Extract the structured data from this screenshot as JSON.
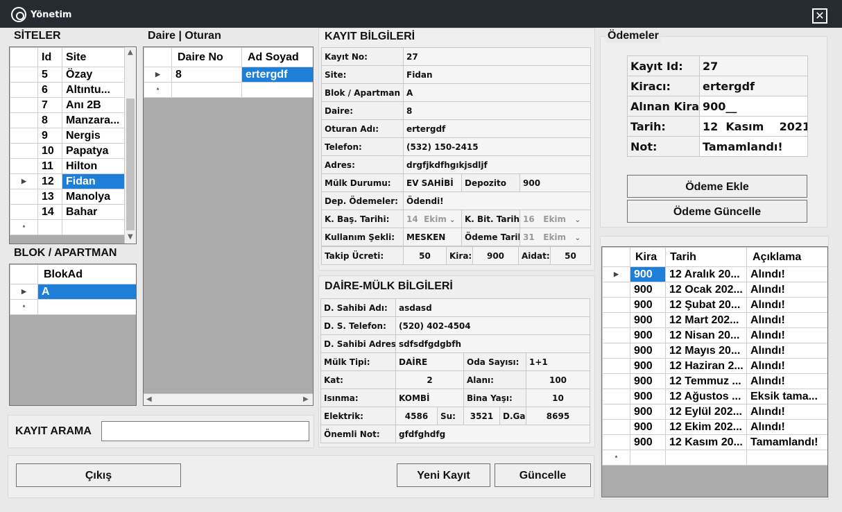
{
  "window": {
    "title": "Yönetim",
    "close": "✕"
  },
  "siteler": {
    "title": "SİTELER",
    "headers": [
      "Id",
      "Site"
    ],
    "rows": [
      {
        "marker": "",
        "id": "5",
        "site": "Özay"
      },
      {
        "marker": "",
        "id": "6",
        "site": "Altıntu..."
      },
      {
        "marker": "",
        "id": "7",
        "site": "Anı 2B"
      },
      {
        "marker": "",
        "id": "8",
        "site": "Manzara..."
      },
      {
        "marker": "",
        "id": "9",
        "site": "Nergis"
      },
      {
        "marker": "",
        "id": "10",
        "site": "Papatya"
      },
      {
        "marker": "",
        "id": "11",
        "site": "Hilton"
      },
      {
        "marker": "▶",
        "id": "12",
        "site": "Fidan"
      },
      {
        "marker": "",
        "id": "13",
        "site": "Manolya"
      },
      {
        "marker": "",
        "id": "14",
        "site": "Bahar"
      },
      {
        "marker": "*",
        "id": "",
        "site": ""
      }
    ]
  },
  "blok": {
    "title": "BLOK / APARTMAN",
    "header": "BlokAd",
    "rows": [
      {
        "marker": "▶",
        "name": "A"
      },
      {
        "marker": "*",
        "name": ""
      }
    ]
  },
  "daire": {
    "title": "Daire | Oturan",
    "headers": [
      "Daire No",
      "Ad Soyad"
    ],
    "rows": [
      {
        "marker": "▶",
        "no": "8",
        "name": "ertergdf"
      },
      {
        "marker": "*",
        "no": "",
        "name": ""
      }
    ]
  },
  "kayit": {
    "title": "KAYIT BİLGİLERİ",
    "no_label": "Kayıt No:",
    "no": "27",
    "site_label": "Site:",
    "site": "Fidan",
    "blok_label": "Blok / Apartman",
    "blok": "A",
    "daire_label": "Daire:",
    "daire": "8",
    "oturan_label": "Oturan Adı:",
    "oturan": "ertergdf",
    "telefon_label": "Telefon:",
    "telefon": "(532) 150-2415",
    "adres_label": "Adres:",
    "adres": "drgfjkdfhgıkjsdljf",
    "mulk_label": "Mülk Durumu:",
    "mulk": "EV SAHİBİ",
    "depozito_label": "Depozito",
    "depozito": "900",
    "dep_odeme_label": "Dep. Ödemeler:",
    "dep_odeme": "Ödendi!",
    "bas_label": "K. Baş. Tarihi:",
    "bas_day": "14",
    "bas_month": "Ekim",
    "bit_label": "K. Bit. Tarihi:",
    "bit_day": "16",
    "bit_month": "Ekim",
    "kullanim_label": "Kullanım Şekli:",
    "kullanim": "MESKEN",
    "odeme_tarih_label": "Ödeme Tarihi:",
    "odeme_day": "31",
    "odeme_month": "Ekim",
    "takip_label": "Takip Ücreti:",
    "takip": "50",
    "kira_label": "Kira:",
    "kira": "900",
    "aidat_label": "Aidat:",
    "aidat": "50"
  },
  "daire_mulk": {
    "title": "DAİRE-MÜLK BİLGİLERİ",
    "sahibi_label": "D. Sahibi Adı:",
    "sahibi": "asdasd",
    "tel_label": "D. S. Telefon:",
    "tel": "(520) 402-4504",
    "adres_label": "D. Sahibi Adres:",
    "adres": "sdfsdfgdgbfh",
    "tip_label": "Mülk Tipi:",
    "tip": "DAİRE",
    "oda_label": "Oda Sayısı:",
    "oda": "1+1",
    "kat_label": "Kat:",
    "kat": "2",
    "alan_label": "Alanı:",
    "alan": "100",
    "isinma_label": "Isınma:",
    "isinma": "KOMBİ",
    "bina_label": "Bina Yaşı:",
    "bina": "10",
    "elektrik_label": "Elektrik:",
    "elektrik": "4586",
    "su_label": "Su:",
    "su": "3521",
    "dgaz_label": "D.Gaz:",
    "dgaz": "8695",
    "not_label": "Önemli Not:",
    "not": "gfdfghdfg"
  },
  "odemeler": {
    "title": "Ödemeler",
    "id_label": "Kayıt Id:",
    "id": "27",
    "kiraci_label": "Kiracı:",
    "kiraci": "ertergdf",
    "kira_label": "Alınan Kira:",
    "kira": "900__",
    "tarih_label": "Tarih:",
    "tarih_day": "12",
    "tarih_month": "Kasım",
    "tarih_year": "2021",
    "not_label": "Not:",
    "not": "Tamamlandı!",
    "add_button": "Ödeme Ekle",
    "update_button": "Ödeme Güncelle"
  },
  "odeme_list": {
    "headers": [
      "Kira",
      "Tarih",
      "Açıklama"
    ],
    "rows": [
      {
        "marker": "▶",
        "kira": "900",
        "tarih": "12 Aralık 20...",
        "aciklama": "Alındı!"
      },
      {
        "marker": "",
        "kira": "900",
        "tarih": "12 Ocak 202...",
        "aciklama": "Alındı!"
      },
      {
        "marker": "",
        "kira": "900",
        "tarih": "12 Şubat 20...",
        "aciklama": "Alındı!"
      },
      {
        "marker": "",
        "kira": "900",
        "tarih": "12 Mart 202...",
        "aciklama": "Alındı!"
      },
      {
        "marker": "",
        "kira": "900",
        "tarih": "12 Nisan 20...",
        "aciklama": "Alındı!"
      },
      {
        "marker": "",
        "kira": "900",
        "tarih": "12 Mayıs 20...",
        "aciklama": "Alındı!"
      },
      {
        "marker": "",
        "kira": "900",
        "tarih": "12 Haziran 2...",
        "aciklama": "Alındı!"
      },
      {
        "marker": "",
        "kira": "900",
        "tarih": "12 Temmuz ...",
        "aciklama": "Alındı!"
      },
      {
        "marker": "",
        "kira": "900",
        "tarih": "12 Ağustos ...",
        "aciklama": "Eksik tama..."
      },
      {
        "marker": "",
        "kira": "900",
        "tarih": "12 Eylül 202...",
        "aciklama": "Alındı!"
      },
      {
        "marker": "",
        "kira": "900",
        "tarih": "12 Ekim 202...",
        "aciklama": "Alındı!"
      },
      {
        "marker": "",
        "kira": "900",
        "tarih": "12 Kasım 20...",
        "aciklama": "Tamamlandı!"
      },
      {
        "marker": "*",
        "kira": "",
        "tarih": "",
        "aciklama": ""
      }
    ]
  },
  "search": {
    "label": "KAYIT ARAMA",
    "value": ""
  },
  "buttons": {
    "exit": "Çıkış",
    "new": "Yeni Kayıt",
    "update": "Güncelle"
  },
  "colors": {
    "titlebar": "#252b30",
    "selection": "#1e7fd8",
    "grid_empty": "#ababab"
  }
}
